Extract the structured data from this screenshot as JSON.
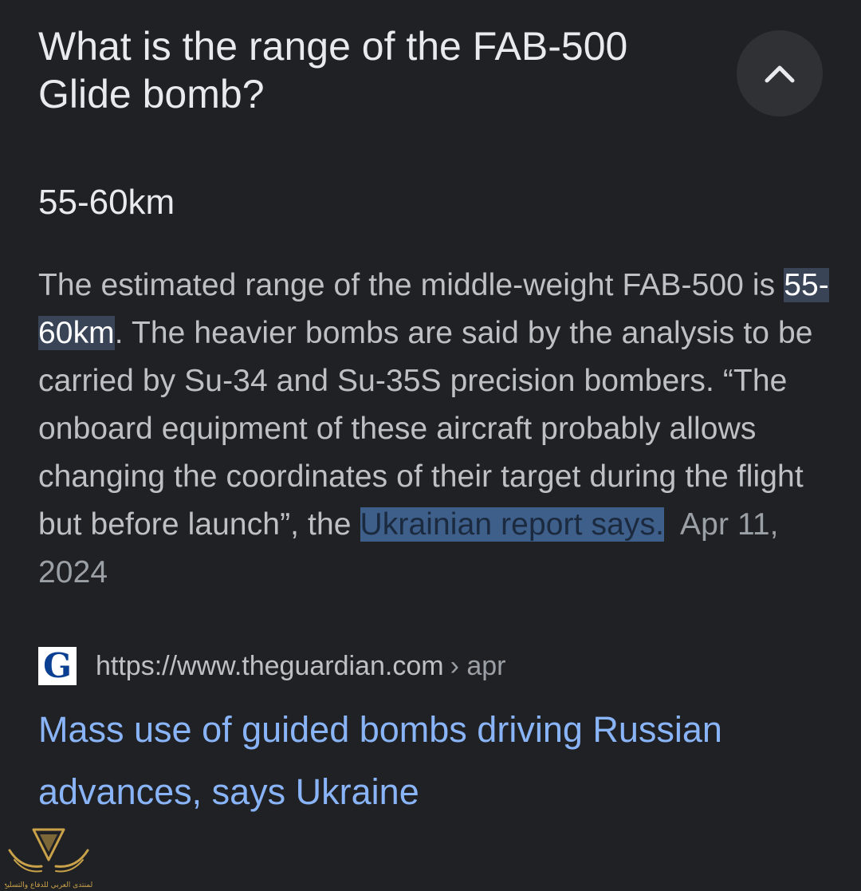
{
  "question": {
    "line1": "What is the range of the FAB-500",
    "line2": "Glide bomb?"
  },
  "collapse_button": {
    "icon": "chevron-up-icon"
  },
  "answer": {
    "value": "55-60km"
  },
  "snippet": {
    "part1": "The estimated range of the middle-weight FAB-500 is ",
    "highlight": "55-60km",
    "part2": ". The heavier bombs are said by the analysis to be carried by Su-34 and Su-35S precision bombers. “The onboard equipment of these aircraft probably allows changing the coordinates of their target during the flight but before launch”, the ",
    "selected": "Ukrainian report says.",
    "date": "Apr 11, 2024"
  },
  "source": {
    "favicon_letter": "G",
    "url": "https://www.theguardian.com",
    "path": "› apr"
  },
  "result": {
    "title_line1": "Mass use of guided bombs driving Russian",
    "title_line2": "advances, says Ukraine"
  },
  "watermark": {
    "text": "المنتدى العربي للدفاع والتسليح"
  },
  "colors": {
    "background": "#202124",
    "link": "#8ab4f8",
    "highlight": "#394457",
    "selection": "#3e5f8a"
  }
}
